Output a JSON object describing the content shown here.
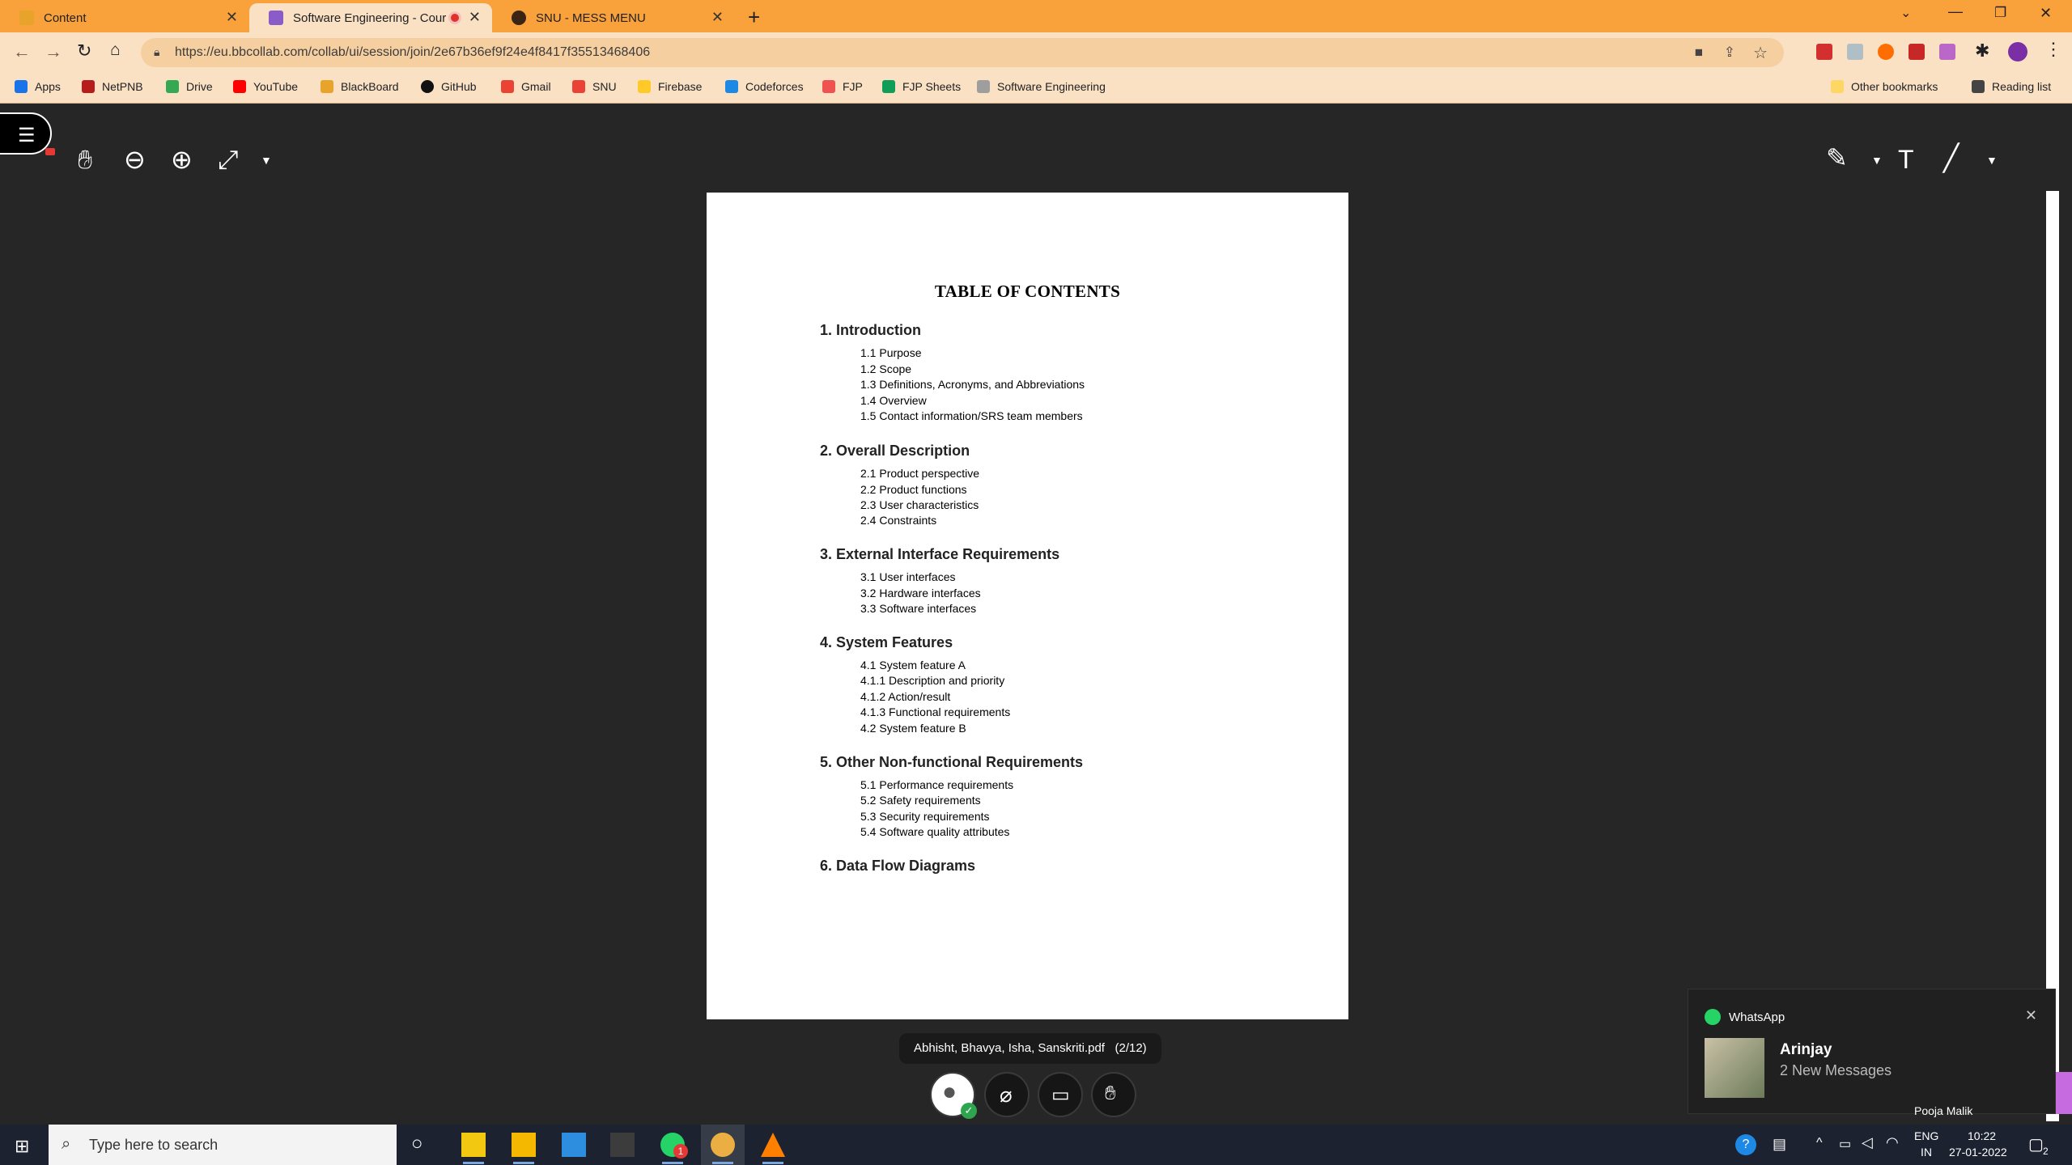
{
  "browser": {
    "tabs": [
      {
        "label": "Content",
        "active": false
      },
      {
        "label": "Software Engineering - Cour",
        "active": true
      },
      {
        "label": "SNU - MESS MENU",
        "active": false
      }
    ],
    "new_tab": "+",
    "url": "https://eu.bbcollab.com/collab/ui/session/join/2e67b36ef9f24e4f8417f35513468406",
    "bookmarks": [
      "Apps",
      "NetPNB",
      "Drive",
      "YouTube",
      "BlackBoard",
      "GitHub",
      "Gmail",
      "SNU",
      "Firebase",
      "Codeforces",
      "FJP",
      "FJP Sheets",
      "Software Engineering"
    ],
    "other_bookmarks": "Other bookmarks",
    "reading_list": "Reading list"
  },
  "document": {
    "title": "TABLE OF CONTENTS",
    "sections": [
      {
        "heading": "1. Introduction",
        "items": [
          "1.1 Purpose",
          "1.2 Scope",
          "1.3 Definitions, Acronyms, and Abbreviations",
          "1.4 Overview",
          "1.5 Contact information/SRS team members"
        ]
      },
      {
        "heading": "2. Overall Description",
        "items": [
          "2.1 Product perspective",
          "2.2 Product functions",
          "2.3 User characteristics",
          "2.4 Constraints"
        ]
      },
      {
        "heading": "3. External Interface Requirements",
        "items": [
          "3.1 User interfaces",
          "3.2 Hardware interfaces",
          "3.3 Software interfaces"
        ]
      },
      {
        "heading": "4. System Features",
        "items": [
          "4.1 System feature A",
          "4.1.1 Description and priority",
          "4.1.2 Action/result",
          "4.1.3 Functional requirements",
          "4.2 System feature B"
        ]
      },
      {
        "heading": "5. Other Non-functional Requirements",
        "items": [
          "5.1 Performance requirements",
          "5.2 Safety requirements",
          "5.3 Security requirements",
          "5.4 Software quality attributes"
        ]
      },
      {
        "heading": "6. Data Flow Diagrams",
        "items": []
      }
    ]
  },
  "viewer": {
    "file_label": "Abhisht, Bhavya, Isha, Sanskriti.pdf",
    "page_indicator": "(2/12)"
  },
  "notification": {
    "app": "WhatsApp",
    "sender": "Arinjay",
    "message": "2 New Messages",
    "behind_text": "Pooja Malik"
  },
  "taskbar": {
    "search_placeholder": "Type here to search",
    "whatsapp_badge": "1",
    "lang": "ENG",
    "region": "IN",
    "time": "10:22",
    "date": "27-01-2022",
    "notif_count": "2"
  }
}
